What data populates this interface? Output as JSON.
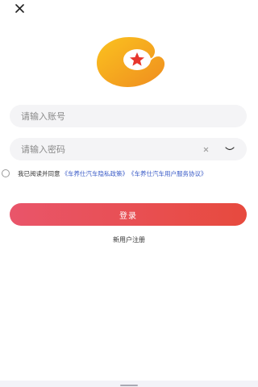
{
  "header": {
    "close_icon": "close-icon"
  },
  "logo": {
    "icon": "star-c-logo",
    "colors": {
      "outer": "#f7b21d",
      "outer_dark": "#ef8d1f",
      "inner": "#ffffff",
      "star": "#e7362d"
    }
  },
  "account": {
    "placeholder": "请输入账号",
    "value": ""
  },
  "password": {
    "placeholder": "请输入密码",
    "value": "",
    "clear_icon": "clear-icon",
    "visibility_icon": "eye-closed-icon"
  },
  "agreement": {
    "prefix": "我已阅读并同意",
    "privacy_link": "《车养仕汽车隐私政策》",
    "service_link": "《车养仕汽车用户服务协议》",
    "checked": false
  },
  "actions": {
    "login_label": "登录",
    "register_label": "新用户注册"
  },
  "colors": {
    "link": "#3a5bc7",
    "button_start": "#e9556a",
    "button_end": "#e74a3e"
  }
}
